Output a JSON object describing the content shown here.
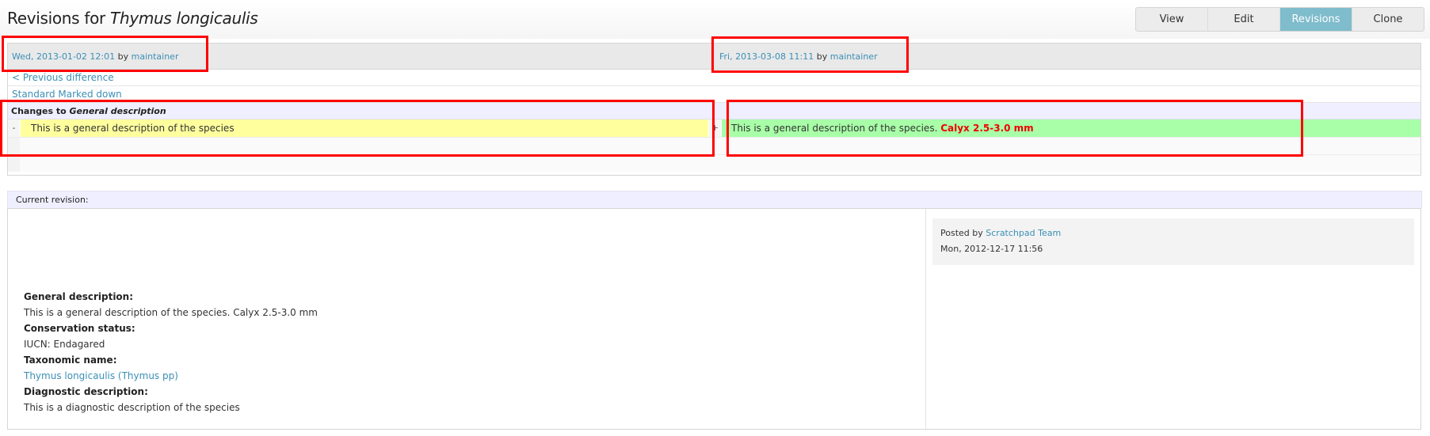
{
  "header": {
    "title_prefix": "Revisions for",
    "title_species": "Thymus longicaulis"
  },
  "tabs": [
    {
      "label": "View"
    },
    {
      "label": "Edit"
    },
    {
      "label": "Revisions",
      "active": true
    },
    {
      "label": "Clone"
    }
  ],
  "diff": {
    "left_rev": {
      "date": "Wed, 2013-01-02 12:01",
      "by": "by",
      "user": "maintainer"
    },
    "right_rev": {
      "date": "Fri, 2013-03-08 11:11",
      "by": "by",
      "user": "maintainer"
    },
    "prev_link": "< Previous difference",
    "view_modes": "Standard Marked down",
    "changes_prefix": "Changes to",
    "changes_field": "General description",
    "deleted_marker": "-",
    "added_marker": "+",
    "deleted_line": "This is a general description of the species",
    "added_line": "This is a general description of the species.",
    "added_insert": "Calyx 2.5-3.0 mm"
  },
  "current": {
    "heading": "Current revision:",
    "posted_by_label": "Posted by",
    "posted_by_user": "Scratchpad Team",
    "posted_date": "Mon, 2012-12-17 11:56",
    "fields": [
      {
        "label": "General description:",
        "value": "This is a general description of the species. Calyx 2.5-3.0 mm",
        "link": false
      },
      {
        "label": "Conservation status:",
        "value": "IUCN: Endagared",
        "link": false
      },
      {
        "label": "Taxonomic name:",
        "value": "Thymus longicaulis (Thymus pp)",
        "link": true
      },
      {
        "label": "Diagnostic description:",
        "value": "This is a diagnostic description of the species",
        "link": false
      }
    ]
  },
  "colors": {
    "link": "#3b8fb5",
    "active_tab": "#7fbccc",
    "deleted_bg": "#ffff9e",
    "added_bg": "#a8ffa8",
    "inserted_text": "#ee0000",
    "highlight_box": "#ff0000"
  }
}
